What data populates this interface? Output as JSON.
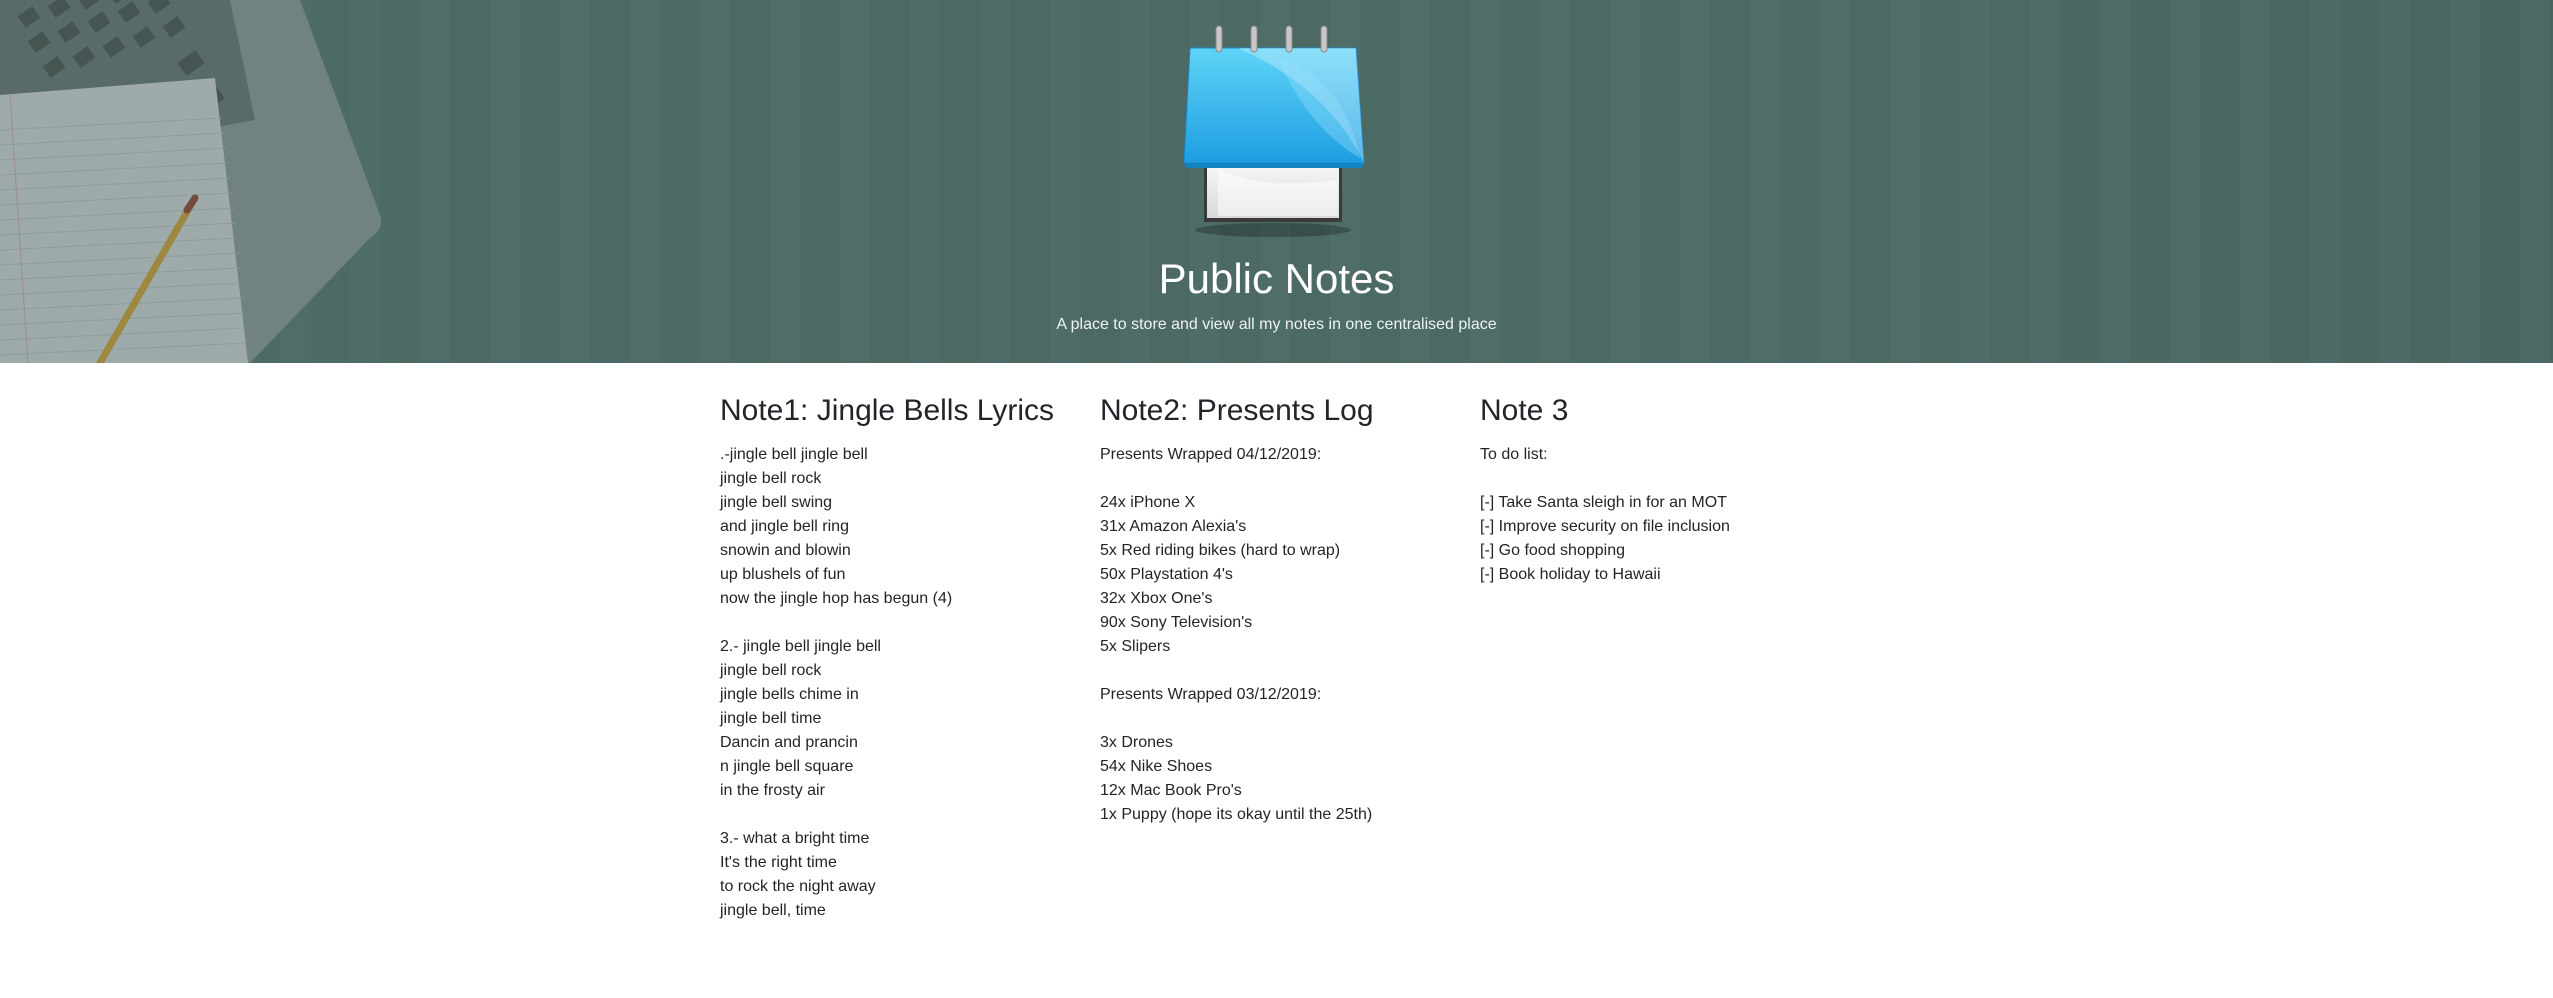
{
  "header": {
    "title": "Public Notes",
    "subtitle": "A place to store and view all my notes in one centralised place",
    "icon": "notepad-icon",
    "colors": {
      "hero_bg": "#4e6c67",
      "icon_blue": "#3ab8f0"
    }
  },
  "notes": [
    {
      "title": "Note1: Jingle Bells Lyrics",
      "lines": [
        ".-jingle bell jingle bell",
        "jingle bell rock",
        "jingle bell swing",
        "and jingle bell ring",
        "snowin and blowin",
        "up blushels of fun",
        "now the jingle hop has begun (4)",
        "",
        "2.- jingle bell jingle bell",
        "jingle bell rock",
        "jingle bells chime in",
        "jingle bell time",
        "Dancin and prancin",
        "n jingle bell square",
        "in the frosty air",
        "",
        "3.- what a bright time",
        "It's the right time",
        "to rock the night away",
        "jingle bell, time"
      ]
    },
    {
      "title": "Note2: Presents Log",
      "lines": [
        "Presents Wrapped 04/12/2019:",
        "",
        "24x iPhone X",
        "31x Amazon Alexia's",
        "5x Red riding bikes (hard to wrap)",
        "50x Playstation 4's",
        "32x Xbox One's",
        "90x Sony Television's",
        "5x Slipers",
        "",
        "Presents Wrapped 03/12/2019:",
        "",
        "3x Drones",
        "54x Nike Shoes",
        "12x Mac Book Pro's",
        "1x Puppy (hope its okay until the 25th)"
      ]
    },
    {
      "title": "Note 3",
      "lines": [
        "To do list:",
        "",
        "[-] Take Santa sleigh in for an MOT",
        "[-] Improve security on file inclusion",
        "[-] Go food shopping",
        "[-] Book holiday to Hawaii"
      ]
    }
  ]
}
